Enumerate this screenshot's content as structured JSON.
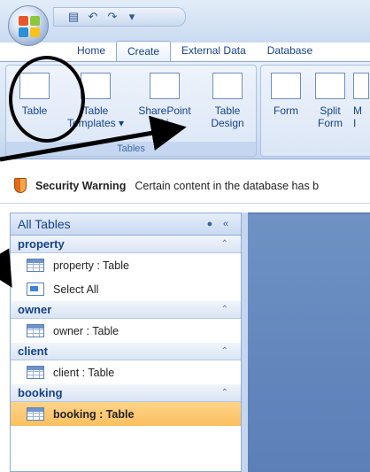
{
  "qat": {
    "save_icon": "save-icon",
    "undo_icon": "undo-icon",
    "redo_icon": "redo-icon",
    "customize_icon": "customize-icon"
  },
  "tabs": [
    "Home",
    "Create",
    "External Data",
    "Database"
  ],
  "active_tab": "Create",
  "ribbon": {
    "tables_group": {
      "label": "Tables",
      "buttons": [
        "Table",
        "Table Templates ▾",
        "SharePoint Lists",
        "Table Design"
      ]
    },
    "forms_group": {
      "buttons": [
        "Form",
        "Split Form",
        "M…"
      ]
    }
  },
  "ribbon_text": {
    "table_1": "Table",
    "templates_1": "Table",
    "templates_2": "Templates ▾",
    "sharepoint_1": "SharePoint",
    "sharepoint_2": "Li",
    "design_1": "Table",
    "design_2": "Design",
    "form_1": "Form",
    "split_1": "Split",
    "split_2": "Form",
    "more_1": "M",
    "more_2": "I"
  },
  "security": {
    "title": "Security Warning",
    "message": "Certain content in the database has b"
  },
  "nav": {
    "header": "All Tables",
    "sections": [
      {
        "name": "property",
        "items": [
          "property : Table",
          "Select All"
        ]
      },
      {
        "name": "owner",
        "items": [
          "owner : Table"
        ]
      },
      {
        "name": "client",
        "items": [
          "client : Table"
        ]
      },
      {
        "name": "booking",
        "items": [
          "booking : Table"
        ]
      }
    ]
  },
  "colors": {
    "accent": "#15428b",
    "selected": "#fbbf5f",
    "workspace": "#6e92c4"
  }
}
